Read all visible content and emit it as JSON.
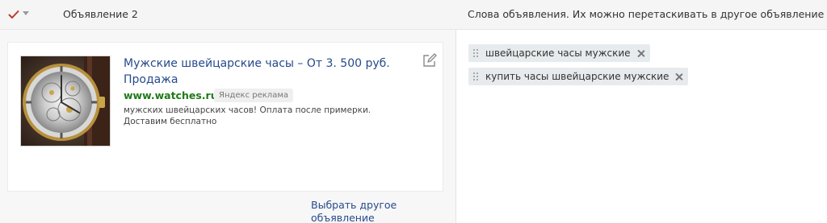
{
  "header": {
    "ad_title": "Объявление 2",
    "words_title": "Слова объявления. Их можно перетаскивать в другое объявление"
  },
  "ad": {
    "title": "Мужские швейцарские часы – От 3. 500 руб. Продажа",
    "url": "www.watches.ru",
    "badge": "Яндекс реклама",
    "text": "мужских швейцарских часов! Оплата после примерки. Доставим бесплатно"
  },
  "choose_link": "Выбрать другое объявление",
  "keywords": [
    {
      "label": "швейцарские часы мужские"
    },
    {
      "label": "купить часы швейцарские мужские"
    }
  ],
  "colors": {
    "link": "#264a8c",
    "url_green": "#1e7a16",
    "check_red": "#c0392b",
    "chip_bg": "#e7ebee"
  },
  "icons": {
    "header_check": "check-icon",
    "header_caret": "caret-down-icon",
    "edit": "edit-icon",
    "grip": "drag-handle-icon",
    "remove": "close-icon"
  }
}
